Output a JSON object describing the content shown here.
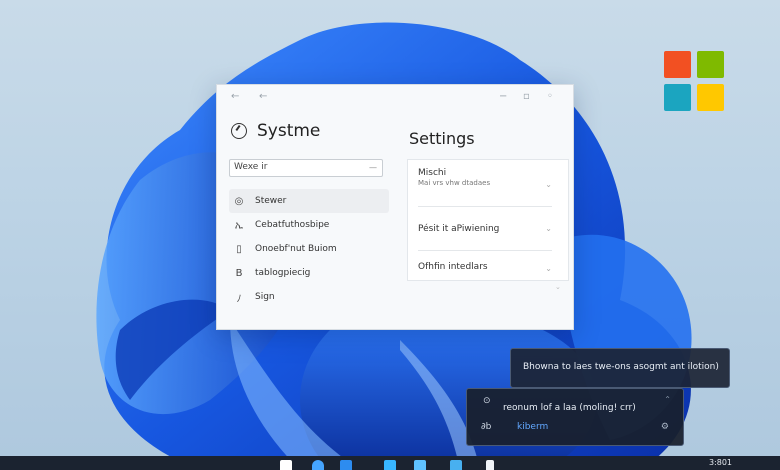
{
  "window": {
    "titlebar": {
      "back": "←",
      "forward": "←",
      "minimize": "−",
      "maximize": "▫",
      "close": "◦"
    },
    "sidebar": {
      "app_title": "Systme",
      "search": {
        "value": "Wexe ir",
        "icon": "—"
      },
      "items": [
        {
          "label": "Stewer",
          "icon": "◎"
        },
        {
          "label": "Cebatfuthosbipe",
          "icon": "ኢ"
        },
        {
          "label": "Onoebf'nut Buiom",
          "icon": "▯"
        },
        {
          "label": "tablogpiecig",
          "icon": "B"
        },
        {
          "label": "Sign",
          "icon": "ﾉ"
        }
      ]
    },
    "main": {
      "title": "Settings",
      "rows": [
        {
          "label": "Mischi",
          "sub": "Mai vrs vhw dtadaes",
          "chevron": "⌄"
        },
        {
          "label": "Pésit it aPiwiening",
          "sub": "",
          "chevron": "⌄"
        },
        {
          "label": "Ofhfin intedlars",
          "sub": "",
          "chevron": "⌄"
        }
      ],
      "footer_chevron": "⌄"
    }
  },
  "notifications": [
    {
      "text": "Bhowna  to  laes  twe-ons  asogmt ant ilotion)"
    },
    {
      "text": "reonum  lof a laa (moling! crr)",
      "icon": "⊙",
      "close": "⌃",
      "action_icon": "∂b",
      "link": "kiberm",
      "settings_icon": "⚙"
    }
  ],
  "taskbar": {
    "clock": "3:801",
    "icons": [
      "start-icon",
      "search-icon",
      "task-view-icon",
      "edge-icon",
      "store-icon",
      "explorer-icon",
      "widget-icon"
    ]
  },
  "colors": {
    "logo_red": "#f25022",
    "logo_green": "#7fba00",
    "logo_blue": "#1ba5c0",
    "logo_yellow": "#ffc800",
    "accent_link": "#62a8ff",
    "wallpaper_blue": "#1b5ee6"
  }
}
